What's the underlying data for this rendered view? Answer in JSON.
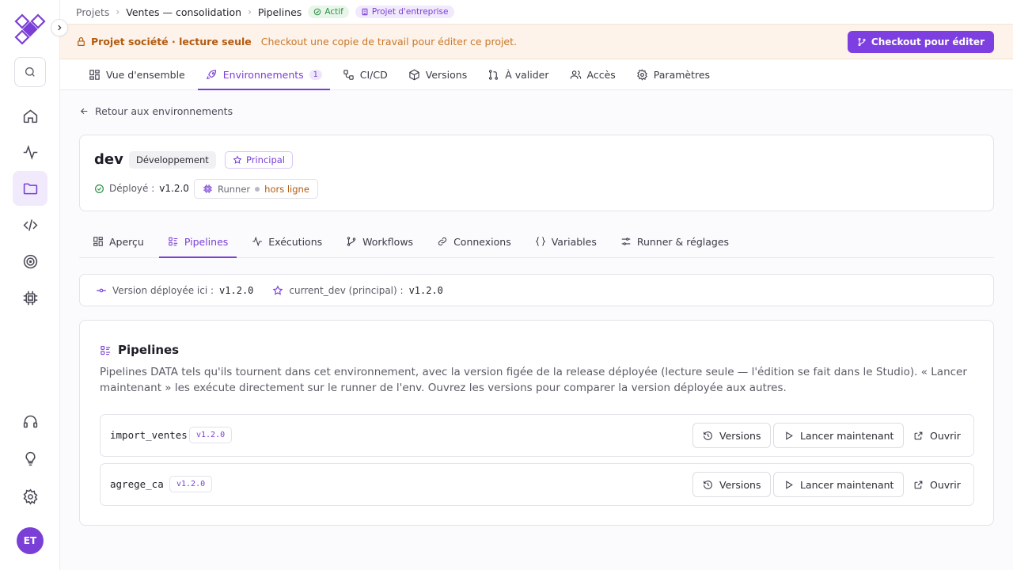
{
  "breadcrumb": {
    "projects": "Projets",
    "project": "Ventes — consolidation",
    "pipelines": "Pipelines"
  },
  "status_badge": "Actif",
  "enterprise_badge": "Projet d'entreprise",
  "banner": {
    "title": "Projet société · lecture seule",
    "message": "Checkout une copie de travail pour éditer ce projet.",
    "checkout_label": "Checkout pour éditer"
  },
  "main_tabs": [
    {
      "label": "Vue d'ensemble"
    },
    {
      "label": "Environnements",
      "count": "1"
    },
    {
      "label": "CI/CD"
    },
    {
      "label": "Versions"
    },
    {
      "label": "À valider"
    },
    {
      "label": "Accès"
    },
    {
      "label": "Paramètres"
    }
  ],
  "back_link": "Retour aux environnements",
  "env": {
    "name": "dev",
    "type_badge": "Développement",
    "principal_badge": "Principal",
    "deployed_label": "Déployé :",
    "deployed_version": "v1.2.0",
    "runner_label": "Runner",
    "runner_status": "hors ligne"
  },
  "sub_tabs": [
    {
      "label": "Aperçu"
    },
    {
      "label": "Pipelines"
    },
    {
      "label": "Exécutions"
    },
    {
      "label": "Workflows"
    },
    {
      "label": "Connexions"
    },
    {
      "label": "Variables"
    },
    {
      "label": "Runner & réglages"
    }
  ],
  "version_bar": {
    "deployed_label": "Version déployée ici :",
    "deployed_value": "v1.2.0",
    "current_label": "current_dev (principal) :",
    "current_value": "v1.2.0"
  },
  "pipelines": {
    "title": "Pipelines",
    "description": "Pipelines DATA tels qu'ils tournent dans cet environnement, avec la version figée de la release déployée (lecture seule — l'édition se fait dans le Studio). « Lancer maintenant » les exécute directement sur le runner de l'env. Ouvrez les versions pour comparer la version déployée aux autres.",
    "versions_label": "Versions",
    "run_label": "Lancer maintenant",
    "open_label": "Ouvrir",
    "items": [
      {
        "name": "import_ventes",
        "version": "v1.2.0"
      },
      {
        "name": "agrege_ca",
        "version": "v1.2.0"
      }
    ]
  },
  "user": {
    "initials": "ET"
  },
  "colors": {
    "accent": "#7a3fd6",
    "warning": "#b35a10",
    "success": "#2f8f47"
  }
}
